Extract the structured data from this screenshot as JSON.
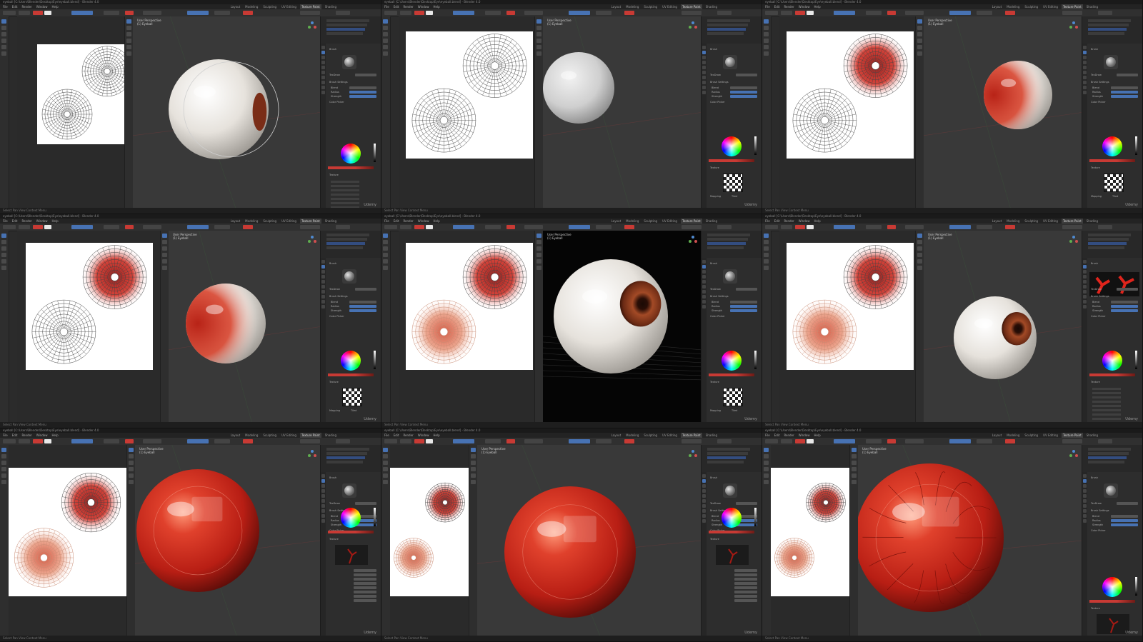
{
  "app": {
    "title": "eyeball [C:\\Users\\Blender\\Desktop\\Eye\\eyeball.blend] - Blender 4.0",
    "menus": [
      "File",
      "Edit",
      "Render",
      "Window",
      "Help"
    ],
    "workspace_tabs": [
      "Layout",
      "Modeling",
      "Sculpting",
      "UV Editing",
      "Texture Paint",
      "Shading"
    ],
    "active_tab": "Texture Paint",
    "viewport_label": "User Perspective",
    "viewport_sublabel": "(1) Eyeball",
    "outliner_items": [
      "Collection",
      "Camera",
      "Eyeball",
      "Light"
    ],
    "properties": {
      "brush_section": "Brush",
      "brush_name": "TexDraw",
      "brush_settings": "Brush Settings",
      "blend_label": "Blend",
      "blend_value": "Mix",
      "radius_label": "Radius",
      "radius_value": "50 px",
      "strength_label": "Strength",
      "strength_value": "1.000",
      "color_picker": "Color Picker",
      "texture_section": "Texture",
      "mapping_label": "Mapping",
      "mapping_value": "Tiled"
    },
    "status_text": "Select  Pan View  Context Menu",
    "watermark": "Udemy"
  },
  "colors": {
    "accent": "#4772b3",
    "brush_red": "#c83a34",
    "panel_bg": "#2b2b2b",
    "viewport_bg": "#393939"
  },
  "icons": [
    "brush-icon",
    "fill-icon",
    "smear-icon",
    "clone-icon",
    "mask-icon",
    "annotate-icon",
    "gizmo-icon"
  ]
}
